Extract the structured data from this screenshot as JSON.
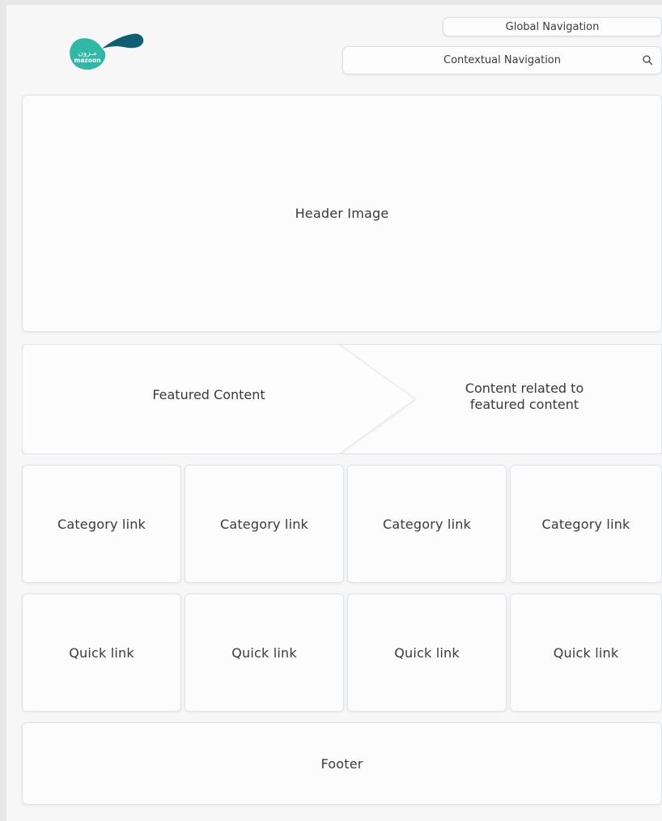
{
  "brand": {
    "name_latin": "mazoon",
    "name_arabic": "مـزون",
    "colors": {
      "teal": "#2fb8a6",
      "dark_teal": "#0f5f73"
    }
  },
  "navigation": {
    "global_label": "Global Navigation",
    "contextual_label": "Contextual Navigation",
    "search_icon": "search-icon"
  },
  "header": {
    "label": "Header Image"
  },
  "featured": {
    "label": "Featured Content",
    "related_label_line1": "Content related to",
    "related_label_line2": "featured content"
  },
  "categories": [
    {
      "label": "Category link"
    },
    {
      "label": "Category link"
    },
    {
      "label": "Category link"
    },
    {
      "label": "Category link"
    }
  ],
  "quick_links": [
    {
      "label": "Quick link"
    },
    {
      "label": "Quick link"
    },
    {
      "label": "Quick link"
    },
    {
      "label": "Quick link"
    }
  ],
  "footer": {
    "label": "Footer"
  }
}
